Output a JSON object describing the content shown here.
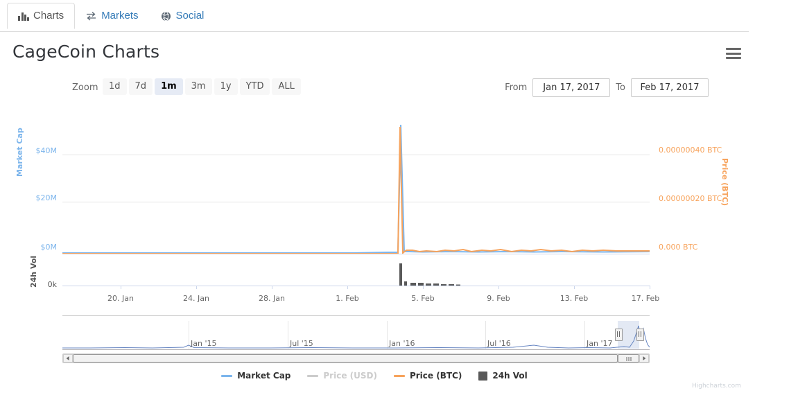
{
  "tabs": [
    {
      "label": "Charts",
      "icon": "bar-chart-icon",
      "active": true
    },
    {
      "label": "Markets",
      "icon": "exchange-arrows-icon",
      "active": false
    },
    {
      "label": "Social",
      "icon": "globe-icon",
      "active": false
    }
  ],
  "header": {
    "title": "CageCoin Charts",
    "menu_icon": "hamburger-menu-icon"
  },
  "rangeselector": {
    "zoom_label": "Zoom",
    "buttons": [
      "1d",
      "7d",
      "1m",
      "3m",
      "1y",
      "YTD",
      "ALL"
    ],
    "selected": "1m",
    "from_label": "From",
    "from_value": "Jan 17, 2017",
    "to_label": "To",
    "to_value": "Feb 17, 2017"
  },
  "legend": [
    {
      "label": "Market Cap",
      "color": "#7cb5ec",
      "marker": "line",
      "disabled": false
    },
    {
      "label": "Price (USD)",
      "color": "#cccccc",
      "marker": "line",
      "disabled": true
    },
    {
      "label": "Price (BTC)",
      "color": "#f7a35c",
      "marker": "line",
      "disabled": false
    },
    {
      "label": "24h Vol",
      "color": "#595959",
      "marker": "square",
      "disabled": false
    }
  ],
  "credit": "Highcharts.com",
  "navigator": {
    "xlabels": [
      "Jan '15",
      "Jul '15",
      "Jan '16",
      "Jul '16",
      "Jan '17"
    ],
    "selection_start_pct": 94.5,
    "selection_end_pct": 98.2
  },
  "chart_data": {
    "type": "line",
    "title": "CageCoin Charts",
    "xlabel": "",
    "x_ticks": [
      "20. Jan",
      "24. Jan",
      "28. Jan",
      "1. Feb",
      "5. Feb",
      "9. Feb",
      "13. Feb",
      "17. Feb"
    ],
    "x_range": [
      "Jan 17, 2017",
      "Feb 17, 2017"
    ],
    "grid": true,
    "legend_position": "bottom",
    "axes": [
      {
        "name": "Market Cap",
        "side": "left",
        "color": "#7cb5ec",
        "ticks": [
          "$40M",
          "$20M",
          "$0M"
        ],
        "tick_values": [
          40000000,
          20000000,
          0
        ],
        "range": [
          0,
          50000000
        ]
      },
      {
        "name": "Price (BTC)",
        "side": "right",
        "color": "#f7a35c",
        "ticks": [
          "0.00000040 BTC",
          "0.00000020 BTC",
          "0.000 BTC"
        ],
        "tick_values": [
          4e-07,
          2e-07,
          0
        ],
        "range": [
          0,
          5e-07
        ]
      },
      {
        "name": "24h Vol",
        "side": "left",
        "color": "#555555",
        "ticks": [
          "0k"
        ],
        "tick_values": [
          0
        ],
        "range": [
          0,
          300000
        ]
      }
    ],
    "series": [
      {
        "name": "Market Cap",
        "color": "#7cb5ec",
        "axis": "Market Cap",
        "unit": "USD",
        "x": [
          "Jan 17",
          "Jan 19",
          "Jan 21",
          "Jan 23",
          "Jan 25",
          "Jan 27",
          "Jan 29",
          "Jan 31",
          "Feb 2",
          "Feb 3",
          "Feb 4",
          "Feb 4.5",
          "Feb 5",
          "Feb 7",
          "Feb 9",
          "Feb 11",
          "Feb 13",
          "Feb 15",
          "Feb 17"
        ],
        "values": [
          120000,
          120000,
          120000,
          130000,
          130000,
          130000,
          140000,
          140000,
          150000,
          160000,
          49500000,
          600000,
          450000,
          430000,
          420000,
          430000,
          440000,
          450000,
          450000
        ]
      },
      {
        "name": "Price (USD)",
        "color": "#cccccc",
        "axis": "Price (USD)",
        "disabled": true,
        "x": [],
        "values": []
      },
      {
        "name": "Price (BTC)",
        "color": "#f7a35c",
        "axis": "Price (BTC)",
        "unit": "BTC",
        "x": [
          "Jan 17",
          "Jan 19",
          "Jan 21",
          "Jan 23",
          "Jan 25",
          "Jan 27",
          "Jan 29",
          "Jan 31",
          "Feb 2",
          "Feb 3",
          "Feb 4",
          "Feb 4.5",
          "Feb 5",
          "Feb 7",
          "Feb 9",
          "Feb 11",
          "Feb 13",
          "Feb 15",
          "Feb 17"
        ],
        "values": [
          1e-09,
          1e-09,
          1e-09,
          1e-09,
          1e-09,
          1e-09,
          1e-09,
          1e-09,
          1e-09,
          2e-09,
          4.85e-07,
          6e-09,
          5e-09,
          5e-09,
          5e-09,
          5e-09,
          5e-09,
          5e-09,
          4e-09
        ]
      },
      {
        "name": "24h Vol",
        "color": "#595959",
        "axis": "24h Vol",
        "type": "column",
        "x": [
          "Feb 4",
          "Feb 5",
          "Feb 6",
          "Feb 7",
          "Feb 8",
          "Feb 9",
          "Feb 10",
          "Feb 11"
        ],
        "values": [
          290000,
          45000,
          32000,
          28000,
          20000,
          16000,
          12000,
          9000
        ]
      }
    ]
  }
}
